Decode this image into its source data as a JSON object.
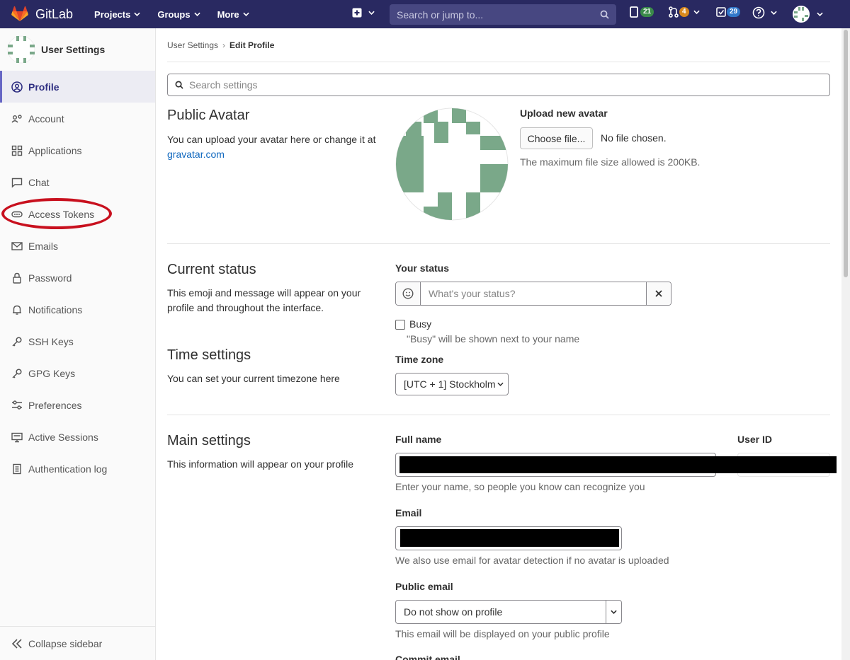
{
  "navbar": {
    "brand": "GitLab",
    "menu": [
      {
        "label": "Projects"
      },
      {
        "label": "Groups"
      },
      {
        "label": "More"
      }
    ],
    "search_placeholder": "Search or jump to...",
    "counts": {
      "issues": "21",
      "merge_requests": "4",
      "todos": "29"
    },
    "colors": {
      "bg": "#292961",
      "issues": "#3a8a4a",
      "merge_requests": "#d8891e",
      "todos": "#3177c9"
    }
  },
  "sidebar": {
    "title": "User Settings",
    "items": [
      {
        "label": "Profile",
        "icon": "profile-icon"
      },
      {
        "label": "Account",
        "icon": "account-icon"
      },
      {
        "label": "Applications",
        "icon": "applications-icon"
      },
      {
        "label": "Chat",
        "icon": "chat-icon"
      },
      {
        "label": "Access Tokens",
        "icon": "token-icon"
      },
      {
        "label": "Emails",
        "icon": "mail-icon"
      },
      {
        "label": "Password",
        "icon": "lock-icon"
      },
      {
        "label": "Notifications",
        "icon": "bell-icon"
      },
      {
        "label": "SSH Keys",
        "icon": "key-icon"
      },
      {
        "label": "GPG Keys",
        "icon": "key-icon"
      },
      {
        "label": "Preferences",
        "icon": "preferences-icon"
      },
      {
        "label": "Active Sessions",
        "icon": "monitor-icon"
      },
      {
        "label": "Authentication log",
        "icon": "log-icon"
      }
    ],
    "collapse_label": "Collapse sidebar"
  },
  "breadcrumb": {
    "parent": "User Settings",
    "current": "Edit Profile"
  },
  "search_settings_placeholder": "Search settings",
  "avatar_section": {
    "title": "Public Avatar",
    "desc": "You can upload your avatar here or change it at",
    "link": "gravatar.com",
    "upload_label": "Upload new avatar",
    "choose_button": "Choose file...",
    "no_file": "No file chosen.",
    "max_size": "The maximum file size allowed is 200KB."
  },
  "status_section": {
    "title": "Current status",
    "desc": "This emoji and message will appear on your profile and throughout the interface.",
    "your_status_label": "Your status",
    "status_placeholder": "What's your status?",
    "busy_label": "Busy",
    "busy_help": "\"Busy\" will be shown next to your name"
  },
  "time_section": {
    "title": "Time settings",
    "desc": "You can set your current timezone here",
    "timezone_label": "Time zone",
    "timezone_value": "[UTC + 1] Stockholm"
  },
  "main_section": {
    "title": "Main settings",
    "desc": "This information will appear on your profile",
    "full_name_label": "Full name",
    "full_name_help": "Enter your name, so people you know can recognize you",
    "user_id_label": "User ID",
    "email_label": "Email",
    "email_help": "We also use email for avatar detection if no avatar is uploaded",
    "public_email_label": "Public email",
    "public_email_value": "Do not show on profile",
    "public_email_help": "This email will be displayed on your public profile",
    "commit_email_label": "Commit email"
  }
}
